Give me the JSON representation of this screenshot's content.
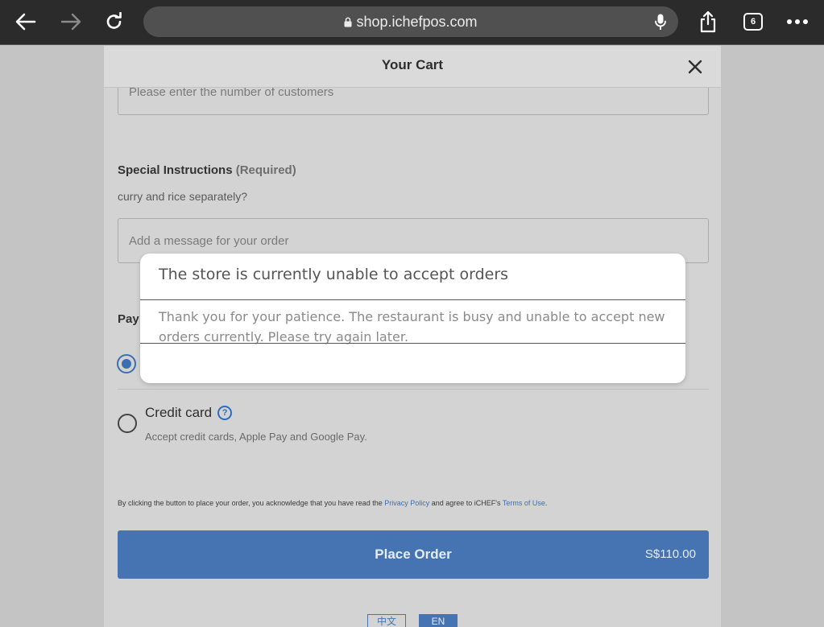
{
  "browser": {
    "url": "shop.ichefpos.com",
    "tab_count": "6"
  },
  "cart": {
    "title": "Your Cart",
    "customers_placeholder": "Please enter the number of customers",
    "special_instructions": {
      "label": "Special Instructions",
      "required": "(Required)",
      "prompt": "curry and rice separately?",
      "placeholder": "Add a message for your order"
    },
    "payment": {
      "label": "Pay",
      "credit_card_title": "Credit card",
      "credit_card_desc": "Accept credit cards, Apple Pay and Google Pay."
    },
    "legal": {
      "prefix": "By clicking the button to place your order, you acknowledge that you have read the ",
      "privacy_link": "Privacy Policy",
      "middle": " and agree to iCHEF's ",
      "terms_link": "Terms of Use",
      "suffix": "."
    },
    "place_order": {
      "label": "Place Order",
      "total": "S$110.00"
    },
    "languages": {
      "zh": "中文",
      "en": "EN"
    }
  },
  "modal": {
    "title": "The store is currently unable to accept orders",
    "body": "Thank you for your patience. The restaurant is busy and unable to accept new orders currently. Please try again later."
  },
  "colors": {
    "accent": "#4674b3",
    "toolbar": "#2b2b2b",
    "overlay_bg": "#c4c4c4"
  }
}
